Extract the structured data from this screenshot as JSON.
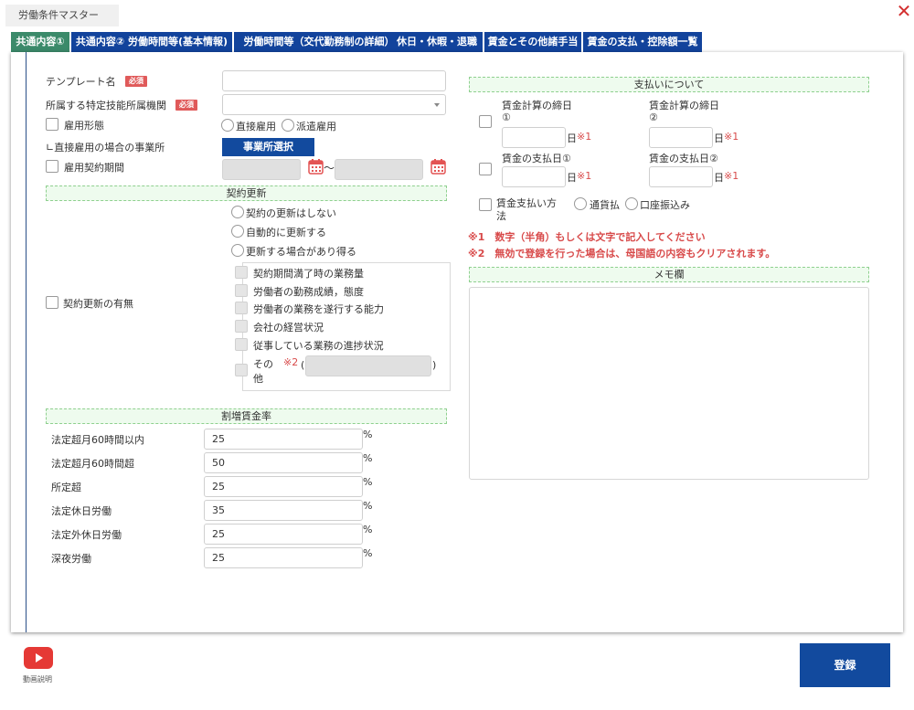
{
  "window": {
    "title": "労働条件マスター"
  },
  "tabs": [
    {
      "label": "共通内容①",
      "active": true
    },
    {
      "label": "共通内容② 労働時間等(基本情報)",
      "active": false
    },
    {
      "label": "労働時間等（交代勤務制の詳細）",
      "active": false
    },
    {
      "label": "休日・休暇・退職",
      "active": false
    },
    {
      "label": "賃金とその他諸手当",
      "active": false
    },
    {
      "label": "賃金の支払・控除額一覧",
      "active": false
    }
  ],
  "left": {
    "template_name_label": "テンプレート名",
    "required_badge": "必須",
    "agency_label": "所属する特定技能所属機関",
    "employment_type_label": "雇用形態",
    "employment_direct": "直接雇用",
    "employment_dispatch": "派遣雇用",
    "direct_office_label": "∟直接雇用の場合の事業所",
    "office_select_button": "事業所選択",
    "contract_period_label": "雇用契約期間",
    "tilde": "〜"
  },
  "renewal": {
    "section_title": "契約更新",
    "option_no_renew": "契約の更新はしない",
    "option_auto": "自動的に更新する",
    "option_may": "更新する場合があり得る",
    "presence_label": "契約更新の有無",
    "reasons": [
      "契約期間満了時の業務量",
      "労働者の勤務成績，態度",
      "労働者の業務を遂行する能力",
      "会社の経営状況",
      "従事している業務の進捗状況"
    ],
    "other_label_1": "その",
    "other_label_2": "他",
    "other_mark": "※2",
    "paren_open": "(",
    "paren_close": ")"
  },
  "premium": {
    "section_title": "割増賃金率",
    "unit": "%",
    "rows": [
      {
        "label": "法定超月60時間以内",
        "value": "25"
      },
      {
        "label": "法定超月60時間超",
        "value": "50"
      },
      {
        "label": "所定超",
        "value": "25"
      },
      {
        "label": "法定休日労働",
        "value": "35"
      },
      {
        "label": "法定外休日労働",
        "value": "25"
      },
      {
        "label": "深夜労働",
        "value": "25"
      }
    ]
  },
  "payment": {
    "section_title": "支払いについて",
    "closing1_a": "賃金計算の締日",
    "closing1_b": "①",
    "closing2_a": "賃金計算の締日",
    "closing2_b": "②",
    "payday1": "賃金の支払日①",
    "payday2": "賃金の支払日②",
    "day_unit": "日",
    "mark1": "※1",
    "method_a": "賃金支払い方",
    "method_b": "法",
    "method_cash": "通貨払",
    "method_bank": "口座振込み",
    "note1": "※1　数字（半角）もしくは文字で記入してください",
    "note2": "※2　無効で登録を行った場合は、母国語の内容もクリアされます。"
  },
  "memo": {
    "section_title": "メモ欄"
  },
  "footer": {
    "video_label": "動画説明",
    "register_button": "登録"
  },
  "colors": {
    "tab_bg": "#12439c",
    "tab_active_bg": "#3b8a6a",
    "button_bg": "#124a9e",
    "required_bg": "#e05a5a",
    "section_bg": "#eefbee",
    "close_red": "#d32f2f"
  }
}
